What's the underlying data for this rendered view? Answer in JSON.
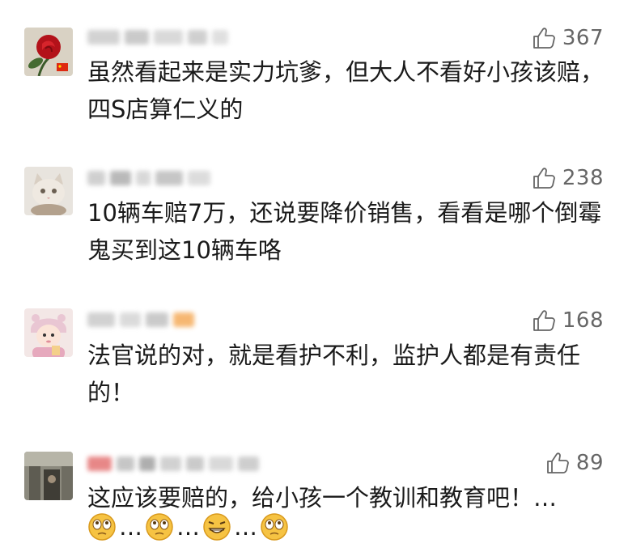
{
  "comments": [
    {
      "likes": "367",
      "text": "虽然看起来是实力坑爹，但大人不看好小孩该赔，四S店算仁义的"
    },
    {
      "likes": "238",
      "text": "10辆车赔7万，还说要降价销售，看看是哪个倒霉鬼买到这10辆车咯"
    },
    {
      "likes": "168",
      "text": "法官说的对，就是看护不利，监护人都是有责任的！"
    },
    {
      "likes": "89",
      "text": "这应该要赔的，给小孩一个教训和教育吧！…",
      "ellipsis": "…"
    }
  ],
  "colors": {
    "like_gray": "#666666",
    "text": "#1a1a1a"
  },
  "icons": [
    "thumbs-up-icon",
    "rose-avatar",
    "cat-avatar",
    "baby-avatar",
    "photo-avatar",
    "eyes-emoji",
    "grin-emoji"
  ]
}
